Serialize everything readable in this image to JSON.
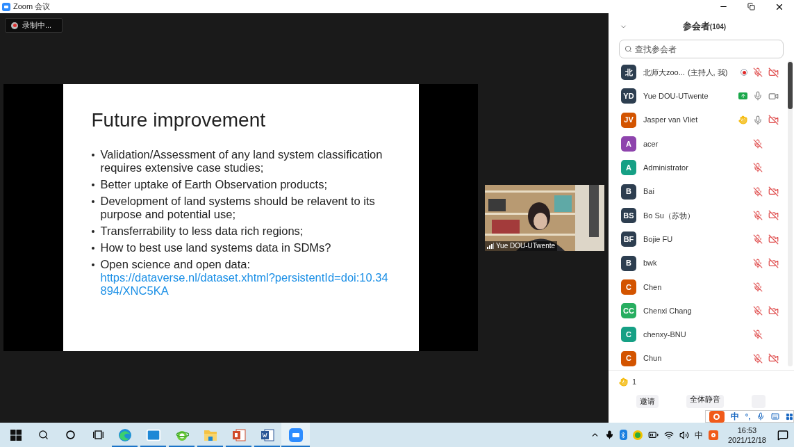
{
  "window": {
    "title": "Zoom 会议"
  },
  "recording": {
    "label": "录制中..."
  },
  "slide": {
    "title": "Future improvement",
    "bullets": [
      {
        "text": "Validation/Assessment of any land system classification requires extensive case studies;"
      },
      {
        "text": "Better uptake of Earth Observation products;"
      },
      {
        "text": "Development of land systems should be relavent to its purpose and potential use;"
      },
      {
        "text": "Transferrability to less data rich regions;"
      },
      {
        "text": "How to best use land systems data in SDMs?"
      },
      {
        "text": "Open science and open data:",
        "link": "https://dataverse.nl/dataset.xhtml?persistentId=doi:10.34894/XNC5KA"
      }
    ]
  },
  "video_tile": {
    "name": "Yue DOU-UTwente"
  },
  "participants_panel": {
    "title": "参会者",
    "count": "(104)",
    "search": {
      "placeholder": "查找参会者"
    },
    "participants": [
      {
        "initials": "北",
        "name": "北师大zoo...",
        "role": "(主持人, 我)",
        "color": "#2d3e50",
        "recording": true,
        "sharing": false,
        "hand_raised": false,
        "muted": true,
        "has_video": true,
        "video_off": true
      },
      {
        "initials": "YD",
        "name": "Yue DOU-UTwente",
        "color": "#2d3e50",
        "recording": false,
        "sharing": true,
        "hand_raised": false,
        "muted": false,
        "has_video": true,
        "video_off": false
      },
      {
        "initials": "JV",
        "name": "Jasper van Vliet",
        "color": "#d35400",
        "recording": false,
        "sharing": false,
        "hand_raised": true,
        "muted": false,
        "has_video": true,
        "video_off": true
      },
      {
        "initials": "A",
        "name": "acer",
        "color": "#8e44ad",
        "recording": false,
        "sharing": false,
        "hand_raised": false,
        "muted": true,
        "has_video": false
      },
      {
        "initials": "A",
        "name": "Administrator",
        "color": "#16a085",
        "recording": false,
        "sharing": false,
        "hand_raised": false,
        "muted": true,
        "has_video": false
      },
      {
        "initials": "B",
        "name": "Bai",
        "color": "#2d3e50",
        "recording": false,
        "sharing": false,
        "hand_raised": false,
        "muted": true,
        "has_video": true,
        "video_off": true
      },
      {
        "initials": "BS",
        "name": "Bo Su（苏勃）",
        "color": "#2d3e50",
        "recording": false,
        "sharing": false,
        "hand_raised": false,
        "muted": true,
        "has_video": true,
        "video_off": true
      },
      {
        "initials": "BF",
        "name": "Bojie FU",
        "color": "#2d3e50",
        "recording": false,
        "sharing": false,
        "hand_raised": false,
        "muted": true,
        "has_video": true,
        "video_off": true
      },
      {
        "initials": "B",
        "name": "bwk",
        "color": "#2d3e50",
        "recording": false,
        "sharing": false,
        "hand_raised": false,
        "muted": true,
        "has_video": true,
        "video_off": true
      },
      {
        "initials": "C",
        "name": "Chen",
        "color": "#d35400",
        "recording": false,
        "sharing": false,
        "hand_raised": false,
        "muted": true,
        "has_video": false
      },
      {
        "initials": "CC",
        "name": "Chenxi Chang",
        "color": "#27ae60",
        "recording": false,
        "sharing": false,
        "hand_raised": false,
        "muted": true,
        "has_video": true,
        "video_off": true
      },
      {
        "initials": "C",
        "name": "chenxy-BNU",
        "color": "#16a085",
        "recording": false,
        "sharing": false,
        "hand_raised": false,
        "muted": true,
        "has_video": false
      },
      {
        "initials": "C",
        "name": "Chun",
        "color": "#d35400",
        "recording": false,
        "sharing": false,
        "hand_raised": false,
        "muted": true,
        "has_video": true,
        "video_off": true
      }
    ],
    "raised_hands": "1",
    "buttons": [
      "邀请",
      "全体静音"
    ]
  },
  "ime_toolbar": {
    "mode": "中",
    "punctuation": "°,"
  },
  "taskbar": {
    "tray_language": "中",
    "time": "16:53",
    "date": "2021/12/18"
  }
}
